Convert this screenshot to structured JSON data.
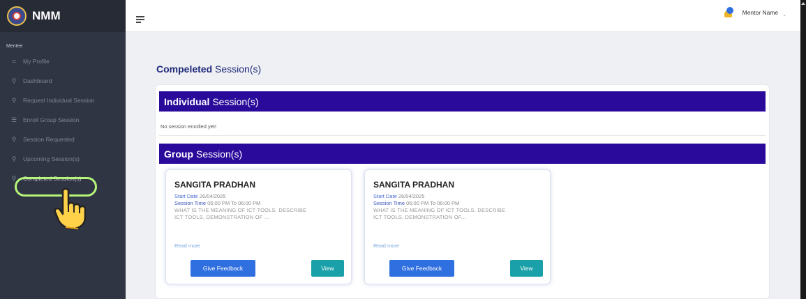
{
  "brand": {
    "name": "NMM"
  },
  "sidebar": {
    "section": "Mentee",
    "items": [
      {
        "label": "My Profile",
        "icon": "⌗"
      },
      {
        "label": "Dashboard",
        "icon": "⚲"
      },
      {
        "label": "Request Individual Session",
        "icon": "⚲"
      },
      {
        "label": "Enroll Group Session",
        "icon": "☰"
      },
      {
        "label": "Session Requested",
        "icon": "⚲"
      },
      {
        "label": "Upcoming Session(s)",
        "icon": "⚲"
      },
      {
        "label": "Completed Session(s)",
        "icon": "⚲"
      }
    ]
  },
  "topbar": {
    "user_name": "Mentor Name"
  },
  "main": {
    "title_bold": "Compeleted",
    "title_rest": "Session(s)",
    "individual": {
      "title_bold": "Individual",
      "title_rest": "Session(s)",
      "empty_text": "No session enrolled yet!"
    },
    "group": {
      "title_bold": "Group",
      "title_rest": "Session(s)"
    },
    "cards": [
      {
        "name": "SANGITA PRADHAN",
        "start_label": "Start Date",
        "start_date": "26/04/2025",
        "time_label": "Session Time",
        "time": "05:00 PM To 06:00 PM",
        "desc_1": "WHAT IS THE MEANING OF ICT TOOLS. DESCRIBE",
        "desc_2": "ICT TOOLS, DEMONSTRATION OF ...",
        "read_more": "Read more",
        "feedback_label": "Give Feedback",
        "view_label": "View"
      },
      {
        "name": "SANGITA PRADHAN",
        "start_label": "Start Date",
        "start_date": "26/04/2025",
        "time_label": "Session Time",
        "time": "05:00 PM To 06:00 PM",
        "desc_1": "WHAT IS THE MEANING OF ICT TOOLS. DESCRIBE",
        "desc_2": "ICT TOOLS, DEMONSTRATION OF...",
        "read_more": "Read more",
        "feedback_label": "Give Feedback",
        "view_label": "View"
      }
    ]
  },
  "colors": {
    "sidebar": "#2f3542",
    "header_bar": "#2a0a9a",
    "primary_button": "#2f6fe0",
    "view_button": "#1aa0a8",
    "highlight": "#b7f57a"
  }
}
